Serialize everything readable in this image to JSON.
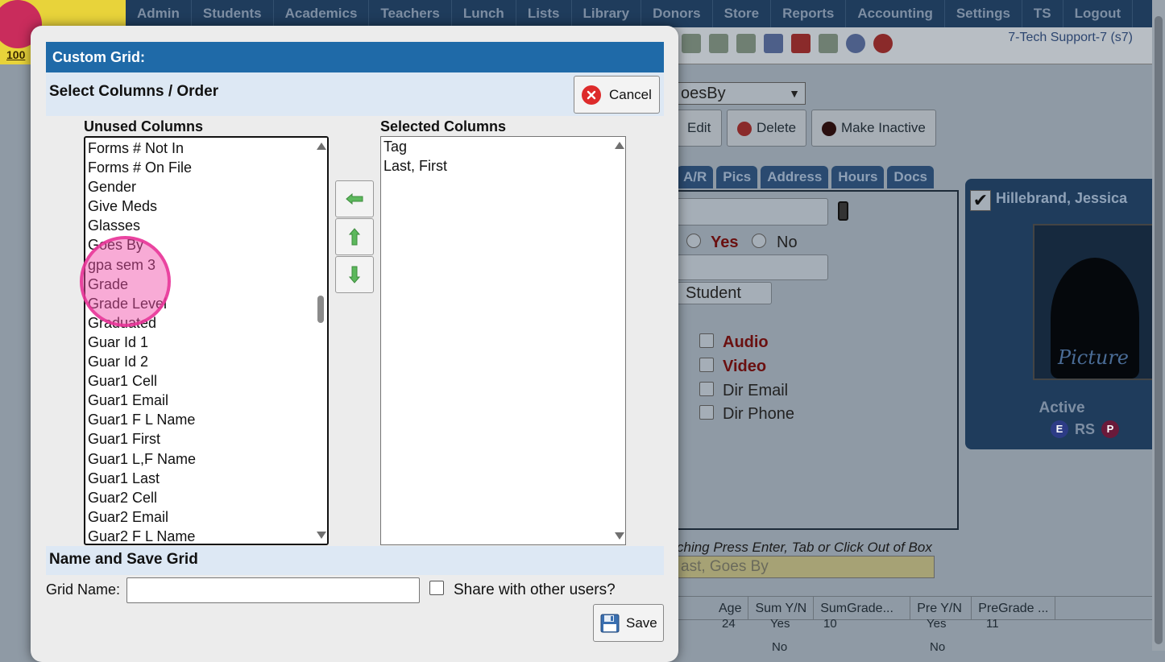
{
  "app": {
    "logo_text": "100",
    "nav": [
      "Admin",
      "Students",
      "Academics",
      "Teachers",
      "Lunch",
      "Lists",
      "Library",
      "Donors",
      "Store",
      "Reports",
      "Accounting",
      "Settings",
      "TS",
      "Logout"
    ],
    "user": "7-Tech Support-7 (s7)"
  },
  "background": {
    "sort_select": "oesBy",
    "buttons": {
      "edit": "Edit",
      "delete": "Delete",
      "make_inactive": "Make Inactive"
    },
    "tabs": [
      "A/R",
      "Pics",
      "Address",
      "Hours",
      "Docs"
    ],
    "yes_label": "Yes",
    "no_label": "No",
    "type_select": "Student",
    "audio": "Audio",
    "video": "Video",
    "dir_email": "Dir Email",
    "dir_phone": "Dir Phone",
    "card": {
      "name": "Hillebrand, Jessica",
      "photo_label": "Picture",
      "status": "Active",
      "badge_e": "E",
      "badge_rs": "RS",
      "badge_p": "P"
    },
    "hint": "ching Press Enter, Tab or Click Out of Box",
    "search_placeholder": "ast, Goes By",
    "grid_headers": [
      "Age",
      "Sum Y/N",
      "SumGrade...",
      "Pre Y/N",
      "PreGrade ..."
    ],
    "grid_row1": {
      "age": "24",
      "sum": "Yes",
      "sumgrade": "10",
      "pre": "Yes",
      "pregrade": "11"
    },
    "grid_row2": {
      "sum": "No",
      "pre": "No"
    }
  },
  "modal": {
    "title": "Custom Grid:",
    "section_select": "Select Columns / Order",
    "cancel_label": "Cancel",
    "unused_label": "Unused Columns",
    "selected_label": "Selected Columns",
    "unused_columns": [
      "Forms # Not In",
      "Forms # On File",
      "Gender",
      "Give Meds",
      "Glasses",
      "Goes By",
      "gpa sem 3",
      "Grade",
      "Grade Level",
      "Graduated",
      "Guar Id 1",
      "Guar Id 2",
      "Guar1 Cell",
      "Guar1 Email",
      "Guar1 F L Name",
      "Guar1 First",
      "Guar1 L,F Name",
      "Guar1 Last",
      "Guar2 Cell",
      "Guar2 Email",
      "Guar2 F L Name"
    ],
    "selected_columns": [
      "Tag",
      "Last, First"
    ],
    "section_save": "Name and Save Grid",
    "grid_name_label": "Grid Name:",
    "grid_name_value": "",
    "share_label": "Share with other users?",
    "share_checked": false,
    "save_label": "Save"
  },
  "colors": {
    "modal_header": "#1f6aa8",
    "section_bg": "#dde8f4",
    "arrow_green": "#5cb85c",
    "cancel_red": "#dd2b2b",
    "click_marker": "#f050aa"
  },
  "icons": [
    "cancel-x-icon",
    "arrow-left-icon",
    "arrow-up-icon",
    "arrow-down-icon",
    "floppy-disk-icon"
  ]
}
